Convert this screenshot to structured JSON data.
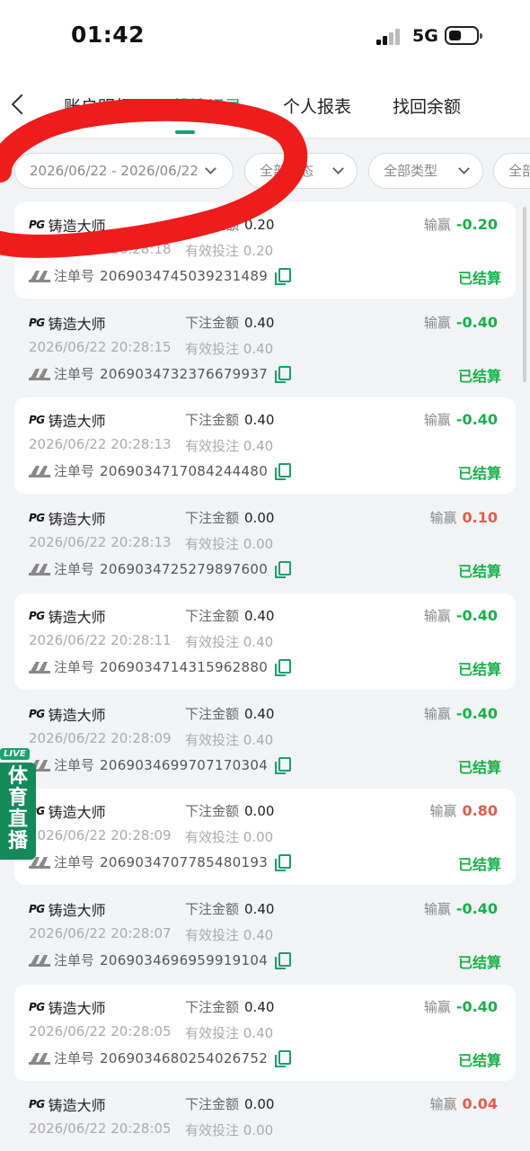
{
  "status_bar": {
    "time": "01:42",
    "network": "5G"
  },
  "nav": {
    "tabs": [
      "账户明细",
      "投注记录",
      "个人报表",
      "找回余额"
    ],
    "active_index": 1
  },
  "filters": {
    "date_range": "2026/06/22 - 2026/06/22",
    "status": "全部状态",
    "type": "全部类型",
    "more": "全部"
  },
  "labels": {
    "bet_amount": "下注金额",
    "valid_bet": "有效投注",
    "order_no": "注单号",
    "win_loss": "输赢"
  },
  "live": {
    "tag": "LIVE",
    "title": "体育直播"
  },
  "records": [
    {
      "game": "铸造大师",
      "bet": "0.20",
      "time": "2026/06/22 20:28:18",
      "valid": "0.20",
      "order": "2069034745039231489",
      "result": "-0.20",
      "status": "已结算"
    },
    {
      "game": "铸造大师",
      "bet": "0.40",
      "time": "2026/06/22 20:28:15",
      "valid": "0.40",
      "order": "2069034732376679937",
      "result": "-0.40",
      "status": "已结算"
    },
    {
      "game": "铸造大师",
      "bet": "0.40",
      "time": "2026/06/22 20:28:13",
      "valid": "0.40",
      "order": "2069034717084244480",
      "result": "-0.40",
      "status": "已结算"
    },
    {
      "game": "铸造大师",
      "bet": "0.00",
      "time": "2026/06/22 20:28:13",
      "valid": "0.00",
      "order": "2069034725279897600",
      "result": "0.10",
      "status": "已结算"
    },
    {
      "game": "铸造大师",
      "bet": "0.40",
      "time": "2026/06/22 20:28:11",
      "valid": "0.40",
      "order": "2069034714315962880",
      "result": "-0.40",
      "status": "已结算"
    },
    {
      "game": "铸造大师",
      "bet": "0.40",
      "time": "2026/06/22 20:28:09",
      "valid": "0.40",
      "order": "2069034699707170304",
      "result": "-0.40",
      "status": "已结算"
    },
    {
      "game": "铸造大师",
      "bet": "0.00",
      "time": "2026/06/22 20:28:09",
      "valid": "0.00",
      "order": "2069034707785480193",
      "result": "0.80",
      "status": "已结算"
    },
    {
      "game": "铸造大师",
      "bet": "0.40",
      "time": "2026/06/22 20:28:07",
      "valid": "0.40",
      "order": "2069034696959919104",
      "result": "-0.40",
      "status": "已结算"
    },
    {
      "game": "铸造大师",
      "bet": "0.40",
      "time": "2026/06/22 20:28:05",
      "valid": "0.40",
      "order": "2069034680254026752",
      "result": "-0.40",
      "status": "已结算"
    },
    {
      "game": "铸造大师",
      "bet": "0.00",
      "time": "2026/06/22 20:28:05",
      "valid": "0.00",
      "order": "",
      "result": "0.04",
      "status": ""
    }
  ],
  "colors": {
    "accent": "#1a9e6e",
    "loss": "#18b04a",
    "gain": "#e25c4b",
    "annotation": "#ee1c1c"
  }
}
